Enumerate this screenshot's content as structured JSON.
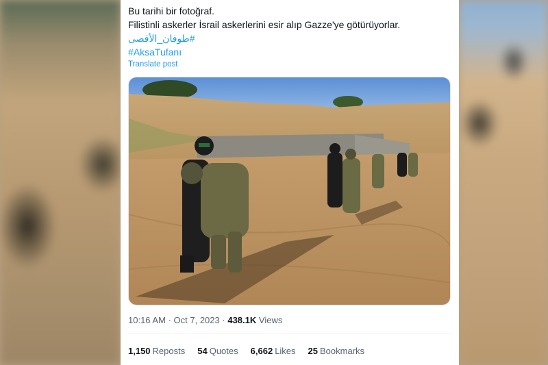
{
  "tweet": {
    "line1": "Bu tarihi bir fotoğraf.",
    "line2": "Filistinli askerler İsrail askerlerini esir alıp Gazze'ye götürüyorlar.",
    "hashtags": [
      "#طوفان_الأقصى",
      "#AksaTufanı"
    ],
    "translate_label": "Translate post"
  },
  "meta": {
    "time": "10:16 AM",
    "separator": "·",
    "date": "Oct 7, 2023",
    "separator2": "·",
    "views_count": "438.1K",
    "views_label": "Views"
  },
  "stats": [
    {
      "count": "1,150",
      "label": "Reposts"
    },
    {
      "count": "54",
      "label": "Quotes"
    },
    {
      "count": "6,662",
      "label": "Likes"
    },
    {
      "count": "25",
      "label": "Bookmarks"
    }
  ],
  "colors": {
    "link": "#1d9bf0",
    "text": "#0f1419",
    "secondary": "#536471"
  },
  "photo": {
    "icon": "post-photo"
  }
}
